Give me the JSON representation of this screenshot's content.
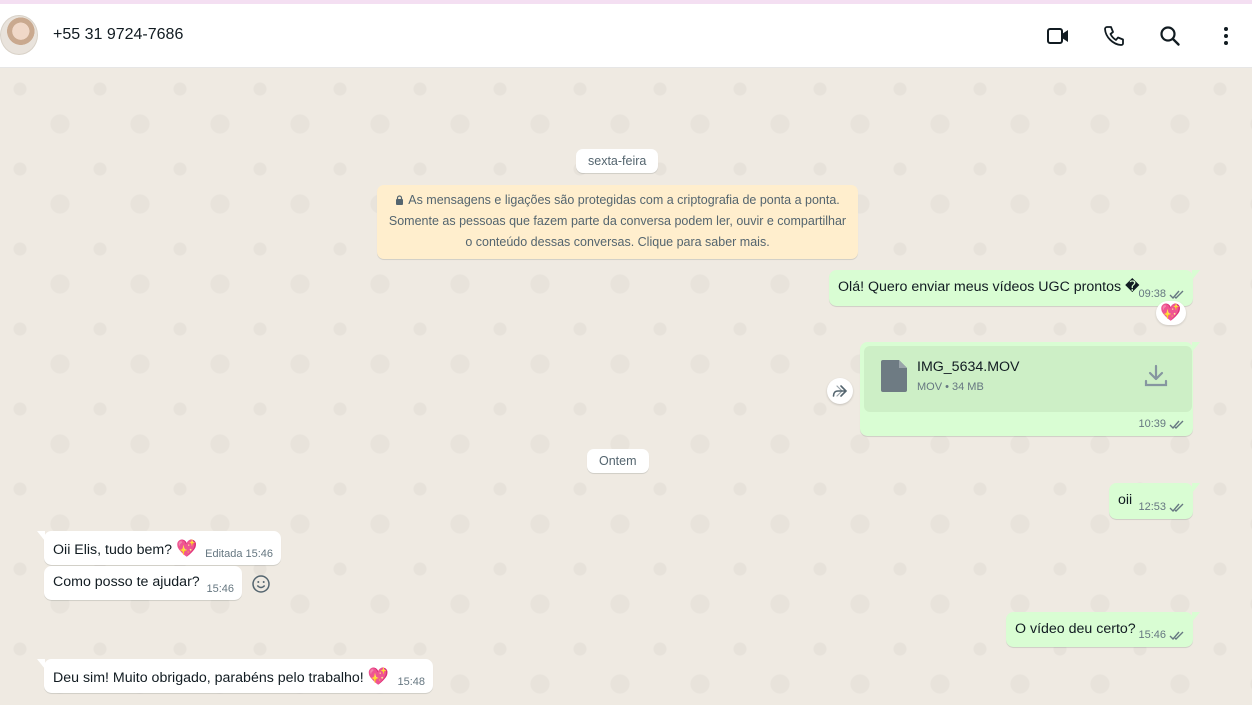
{
  "header": {
    "contact_name": "+55 31 9724-7686"
  },
  "icons": {
    "video": "video-call-icon",
    "phone": "phone-icon",
    "search": "search-icon",
    "menu": "more-vertical-icon"
  },
  "colors": {
    "outgoing_bubble": "#d9fdd3",
    "incoming_bubble": "#ffffff",
    "system_note": "#ffeecd",
    "chat_background": "#efeae2"
  },
  "chat": {
    "date_friday": "sexta-feira",
    "encryption_line1": "As mensagens e ligações são protegidas com a criptografia de ponta a ponta.",
    "encryption_line2": "Somente as pessoas que fazem parte da conversa podem ler, ouvir e compartilhar",
    "encryption_line3": "o conteúdo dessas conversas. Clique para saber mais.",
    "date_yesterday": "Ontem",
    "messages": [
      {
        "text": "Olá! Quero enviar meus vídeos UGC prontos �",
        "time": "09:38",
        "reaction": "💖"
      },
      {
        "file_name": "IMG_5634.MOV",
        "file_meta": "MOV • 34 MB",
        "time": "10:39"
      },
      {
        "text": "oii",
        "time": "12:53"
      },
      {
        "text": "Oii Elis, tudo bem? ",
        "emoji": "💖",
        "edited": "Editada",
        "time": "15:46"
      },
      {
        "text": "Como posso te ajudar?",
        "time": "15:46"
      },
      {
        "text": "O vídeo deu certo?",
        "time": "15:46"
      },
      {
        "text": "Deu sim! Muito obrigado, parabéns pelo trabalho! ",
        "emoji": "💖",
        "time": "15:48"
      }
    ]
  }
}
